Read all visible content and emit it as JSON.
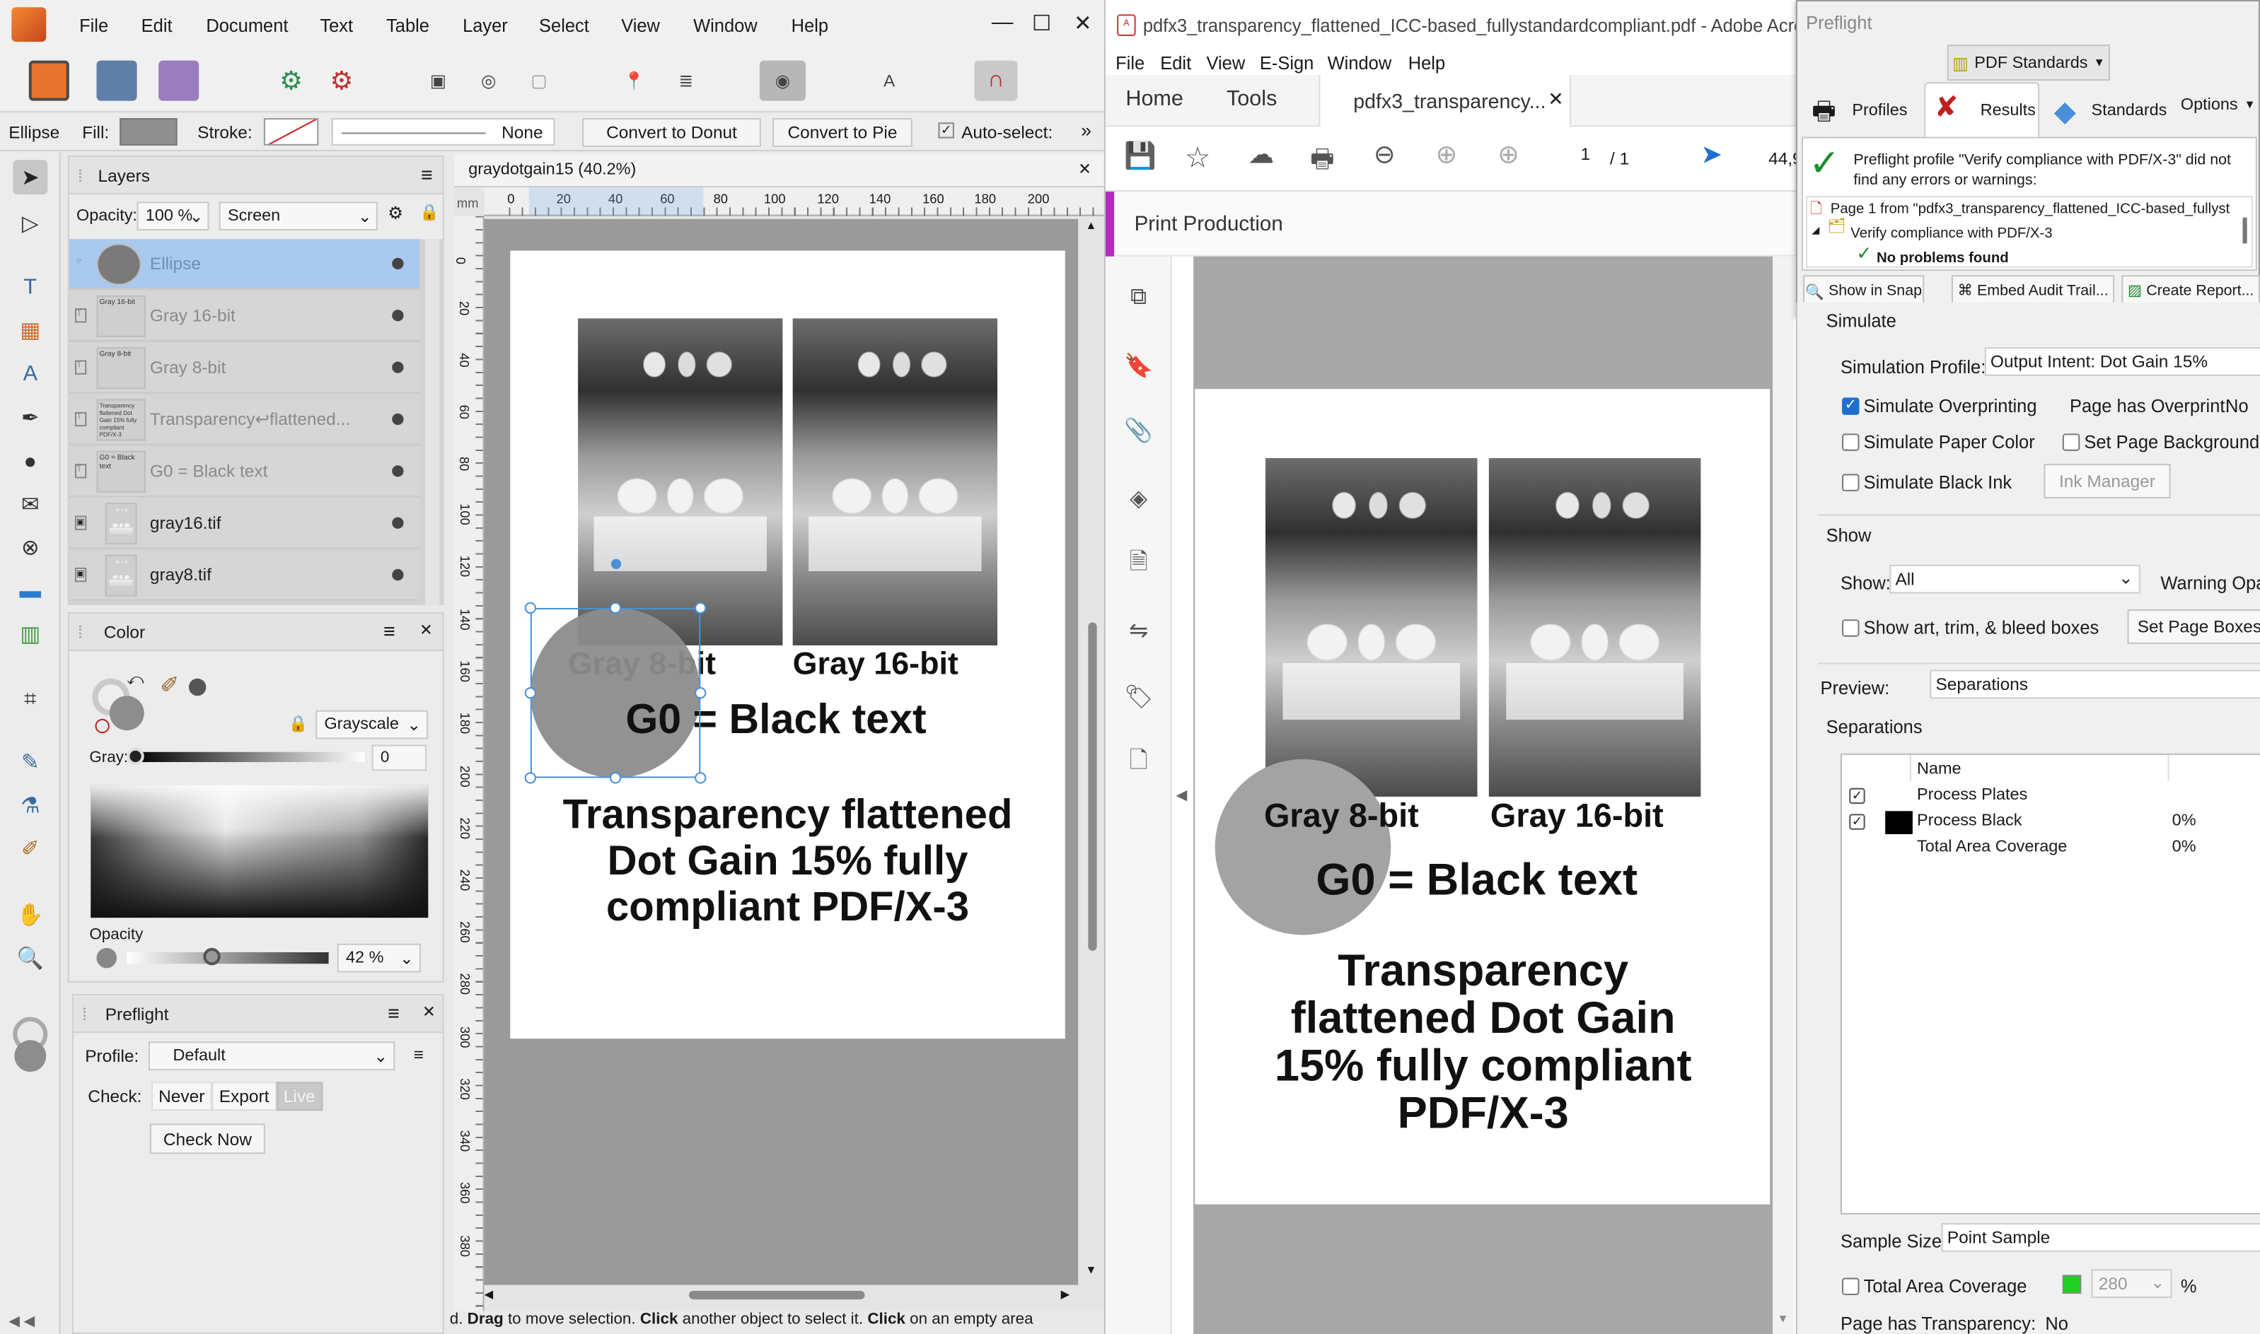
{
  "affinity": {
    "menu": [
      "File",
      "Edit",
      "Document",
      "Text",
      "Table",
      "Layer",
      "Select",
      "View",
      "Window",
      "Help"
    ],
    "context": {
      "object": "Ellipse",
      "fill_label": "Fill:",
      "stroke_label": "Stroke:",
      "stroke_value": "None",
      "convert_donut": "Convert to Donut",
      "convert_pie": "Convert to Pie",
      "autoselect": "Auto-select:"
    },
    "layers": {
      "title": "Layers",
      "opacity_label": "Opacity:",
      "opacity_value": "100 %",
      "blend_mode": "Screen",
      "items": [
        {
          "name": "Ellipse",
          "thumb": ""
        },
        {
          "name": "Gray 16-bit",
          "thumb": "Gray 16-bit"
        },
        {
          "name": "Gray 8-bit",
          "thumb": "Gray 8-bit"
        },
        {
          "name": "Transparency↩flattened...",
          "thumb": "Transparency flattened Dot Gain 15% fully compliant PDF/X-3"
        },
        {
          "name": "G0 = Black text",
          "thumb": "G0 = Black text"
        },
        {
          "name": "gray16.tif",
          "thumb": ""
        },
        {
          "name": "gray8.tif",
          "thumb": ""
        }
      ]
    },
    "color": {
      "title": "Color",
      "model": "Grayscale",
      "gray_label": "Gray:",
      "gray_value": "0",
      "opacity_label": "Opacity",
      "opacity_value": "42 %",
      "opacity_fraction": 0.42
    },
    "preflight": {
      "title": "Preflight",
      "profile_label": "Profile:",
      "profile_value": "Default",
      "check_label": "Check:",
      "check_options": [
        "Never",
        "Export",
        "Live"
      ],
      "check_now": "Check Now"
    },
    "doc_tab": "graydotgain15 (40.2%)",
    "ruler_unit": "mm",
    "hruler": [
      "0",
      "20",
      "40",
      "60",
      "80",
      "100",
      "120",
      "140",
      "160",
      "180",
      "200"
    ],
    "vruler": [
      "0",
      "20",
      "40",
      "60",
      "80",
      "100",
      "120",
      "140",
      "160",
      "180",
      "200",
      "220",
      "240",
      "260",
      "280",
      "300",
      "320",
      "340",
      "360",
      "380"
    ],
    "page_text": {
      "label8": "Gray 8-bit",
      "label16": "Gray 16-bit",
      "g0": "G0 = Black text",
      "title": "Transparency flattened Dot Gain 15% fully compliant PDF/X-3"
    },
    "status": {
      "prefix": "d. ",
      "drag": "Drag",
      "t1": " to move selection. ",
      "click1": "Click",
      "t2": " another object to select it. ",
      "click2": "Click",
      "t3": " on an empty area"
    }
  },
  "acrobat": {
    "title": "pdfx3_transparency_flattened_ICC-based_fullystandardcompliant.pdf - Adobe Acrobat P",
    "menu": [
      "File",
      "Edit",
      "View",
      "E-Sign",
      "Window",
      "Help"
    ],
    "tabs": {
      "home": "Home",
      "tools": "Tools",
      "doc": "pdfx3_transparency..."
    },
    "page_current": "1",
    "page_total": "/ 1",
    "zoom_partial": "44,9",
    "tool_header": "Print Production",
    "page_text": {
      "label8": "Gray 8-bit",
      "label16": "Gray 16-bit",
      "g0": "G0 = Black text",
      "title": "Transparency flattened Dot Gain 15% fully compliant PDF/X-3"
    }
  },
  "preflight_dialog": {
    "title": "Preflight",
    "standards_button": "PDF Standards",
    "tabs": [
      "Profiles",
      "Results",
      "Standards"
    ],
    "options": "Options",
    "result_text": "Preflight profile \"Verify compliance with PDF/X-3\" did not find any errors or warnings:",
    "tree": {
      "page": "Page 1 from \"pdfx3_transparency_flattened_ICC-based_fullyst",
      "verify": "Verify compliance with PDF/X-3",
      "noproblems": "No problems found"
    },
    "buttons": [
      "Show in Snap",
      "Embed Audit Trail...",
      "Create Report..."
    ]
  },
  "output_preview": {
    "simulate_header": "Simulate",
    "sim_profile_label": "Simulation Profile:",
    "sim_profile_value": "Output Intent: Dot Gain 15%",
    "sim_overprint": "Simulate Overprinting",
    "page_overprint": "Page has Overprint:",
    "page_overprint_value": "No",
    "paper_color": "Simulate Paper Color",
    "page_background": "Set Page Background C",
    "black_ink": "Simulate Black Ink",
    "ink_manager": "Ink Manager",
    "show_header": "Show",
    "show_label": "Show:",
    "show_value": "All",
    "warning_opacity": "Warning Opa",
    "art_trim": "Show art, trim, & bleed boxes",
    "set_page_boxes": "Set Page Boxes",
    "preview_label": "Preview:",
    "preview_value": "Separations",
    "separations_header": "Separations",
    "sep_col_name": "Name",
    "separations": [
      {
        "name": "Process Plates",
        "value": ""
      },
      {
        "name": "Process Black",
        "value": "0%"
      },
      {
        "name": "Total Area Coverage",
        "value": "0%"
      }
    ],
    "sample_size_label": "Sample Size:",
    "sample_size_value": "Point Sample",
    "tac_label": "Total Area Coverage",
    "tac_value": "280",
    "tac_unit": "%",
    "page_transparency": "Page has Transparency:",
    "page_transparency_value": "No"
  },
  "colors": {
    "accent_blue": "#1f6fd0",
    "selection_blue": "#a9c9ee",
    "ellipse_gray": "#8c8c8c",
    "acrobat_red": "#d9322d",
    "print_production_bar": "#b32bc2",
    "check_green": "#1d8c2a",
    "tac_green": "#1fd21f"
  }
}
